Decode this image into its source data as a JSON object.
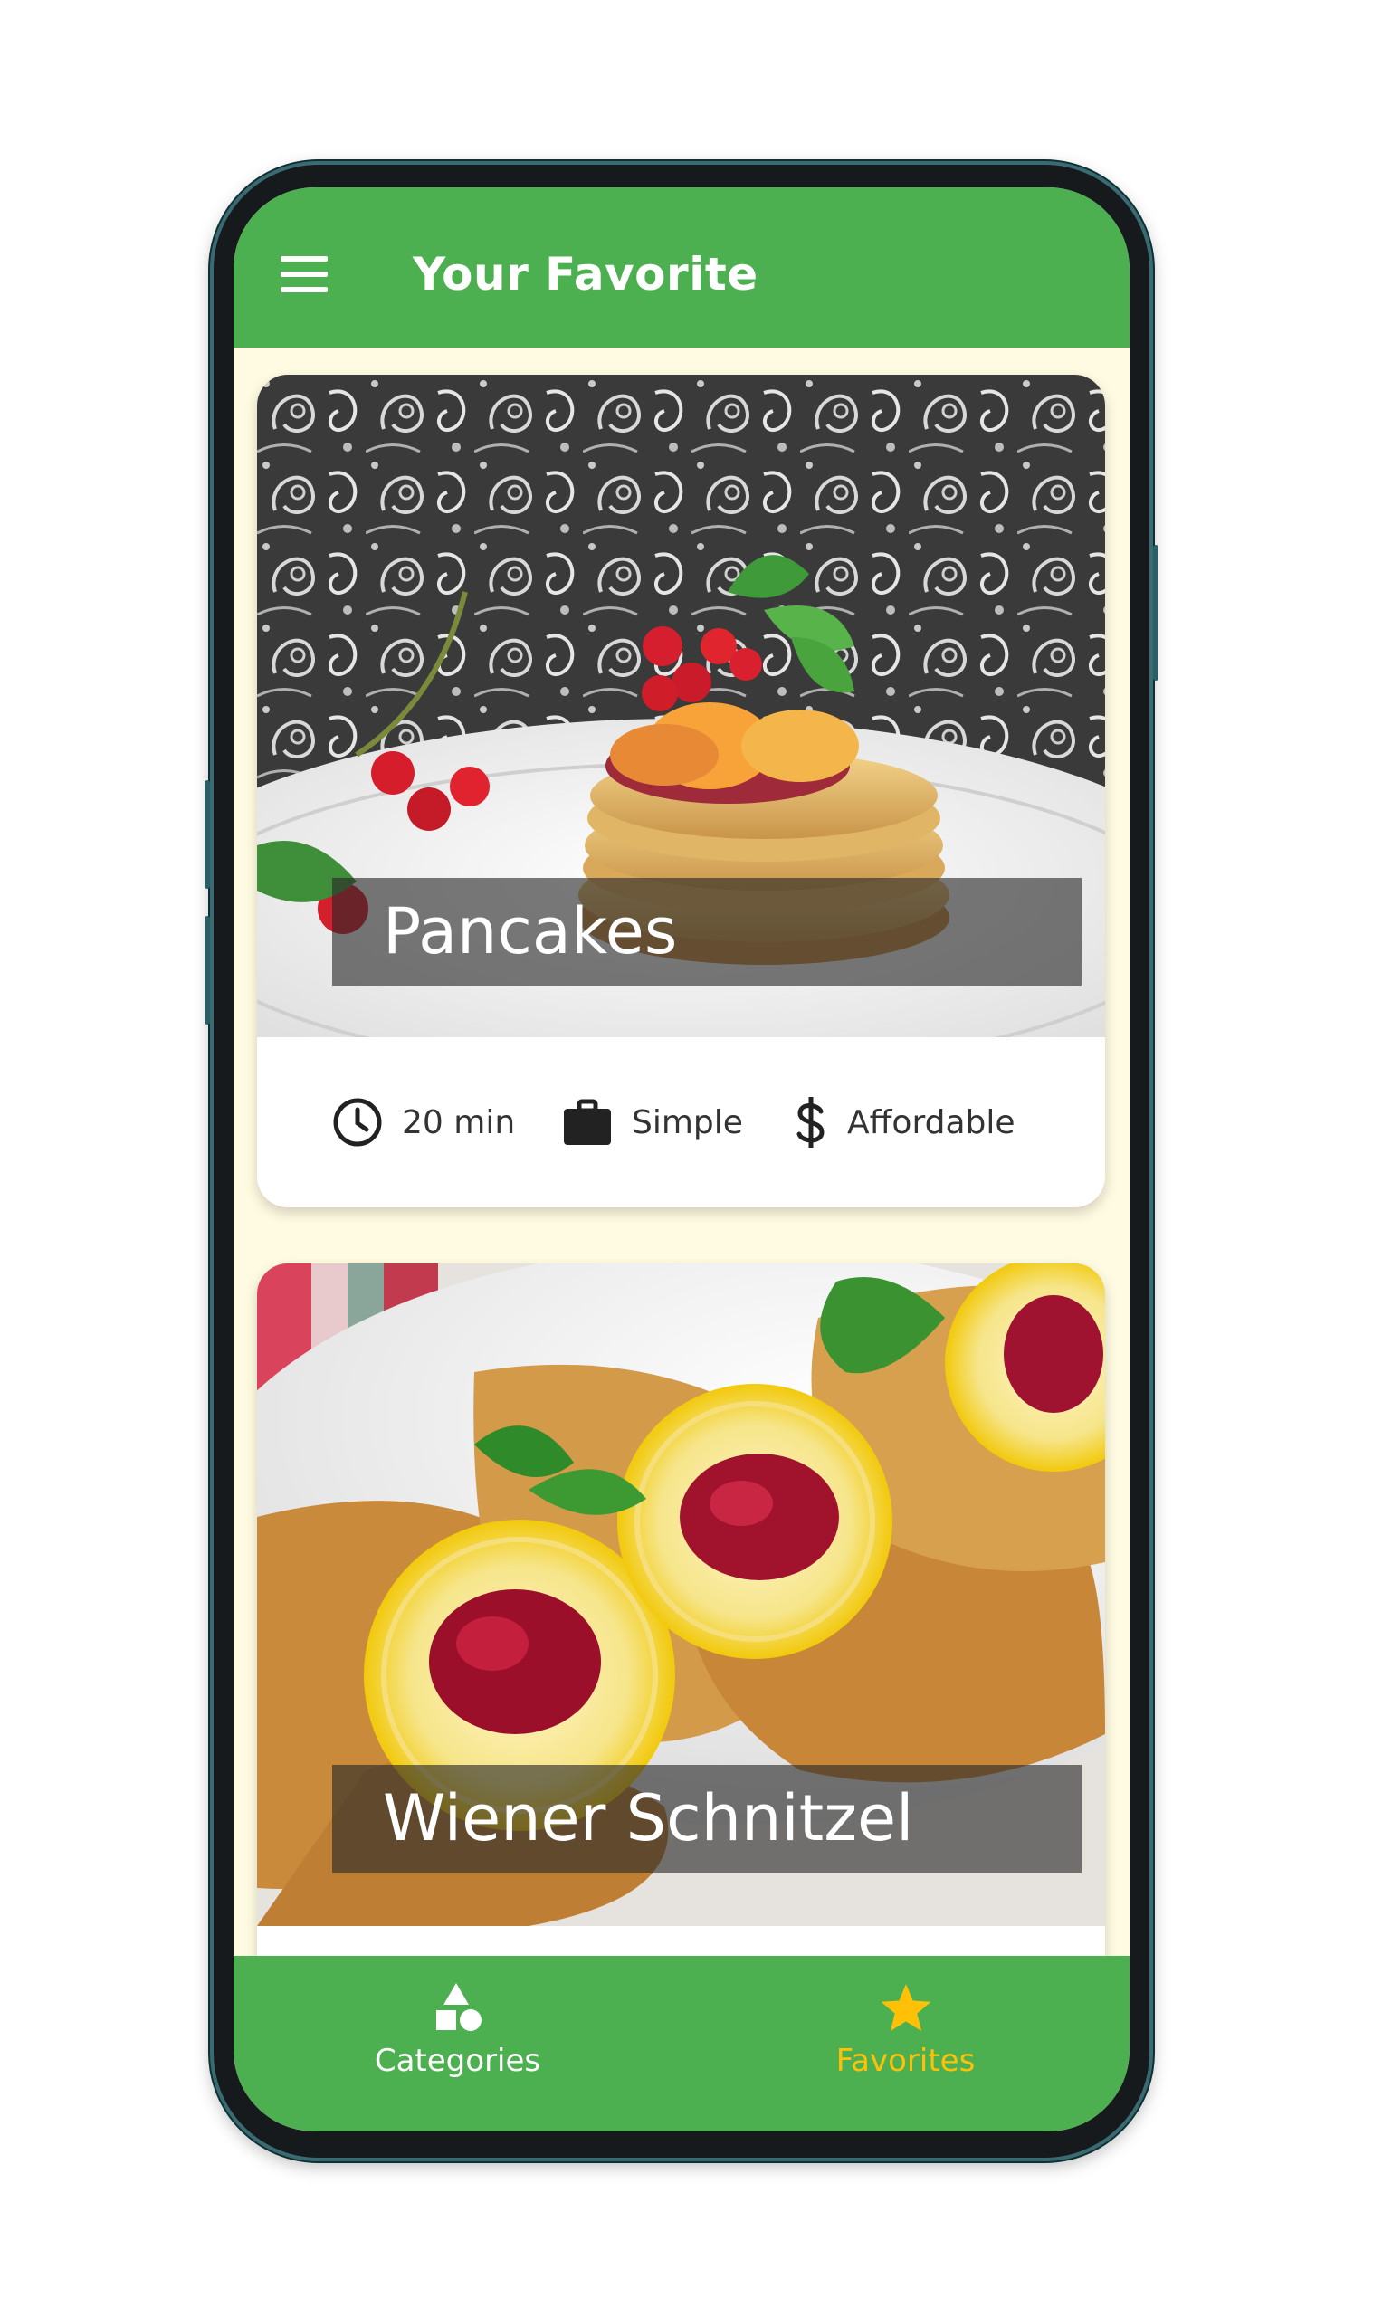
{
  "app_bar": {
    "menu_icon": "hamburger-menu-icon",
    "title": "Your Favorite",
    "color": "#4caf50"
  },
  "meals": [
    {
      "title": "Pancakes",
      "duration": "20 min",
      "complexity": "Simple",
      "affordability": "Affordable"
    },
    {
      "title": "Wiener Schnitzel"
    }
  ],
  "meta_icons": {
    "duration": "clock-icon",
    "complexity": "briefcase-icon",
    "affordability": "dollar-icon"
  },
  "bottom_nav": {
    "items": [
      {
        "label": "Categories",
        "icon": "category-shapes-icon",
        "active": false
      },
      {
        "label": "Favorites",
        "icon": "star-icon",
        "active": true
      }
    ],
    "active_color": "#ffc107",
    "inactive_color": "#ffffff"
  },
  "colors": {
    "primary": "#4caf50",
    "accent": "#ffc107",
    "background": "#fffbe2"
  }
}
